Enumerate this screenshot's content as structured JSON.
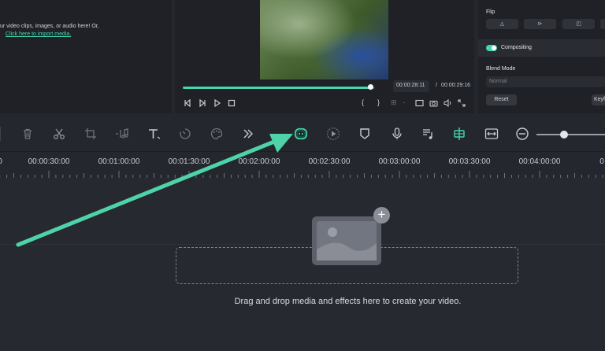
{
  "media_panel": {
    "text": "ur video clips, images, or audio here! Or,",
    "link": "Click here to import media."
  },
  "player": {
    "current_time": "00:00:28:11",
    "separator": "/",
    "total_time": "00:00:29:16",
    "progress_percent": 0.992
  },
  "properties": {
    "flip_label": "Flip",
    "compositing_label": "Compositing",
    "compositing_enabled": true,
    "blend_mode_label": "Blend Mode",
    "blend_mode_value": "Normal",
    "reset_label": "Reset",
    "keyframe_label": "Keyf"
  },
  "toolbar": {
    "icons": [
      "delete-icon",
      "cut-icon",
      "crop-icon",
      "audio-icon",
      "text-icon",
      "speed-icon",
      "color-icon",
      "more-icon",
      "ai-robot-icon",
      "play-circle-icon",
      "marker-icon",
      "mic-icon",
      "audio-list-icon",
      "snap-icon",
      "fit-icon",
      "zoom-out-icon"
    ],
    "accent_color": "#42d7b0",
    "zoom_level": 0.4
  },
  "ruler": {
    "labels": [
      "00:00:30:00",
      "00:01:00:00",
      "00:01:30:00",
      "00:02:00:00",
      "00:02:30:00",
      "00:03:00:00",
      "00:03:30:00",
      "00:04:00:00"
    ]
  },
  "timeline": {
    "drop_text": "Drag and drop media and effects here to create your video."
  },
  "annotation": {
    "arrow_color": "#4ed3a8"
  }
}
